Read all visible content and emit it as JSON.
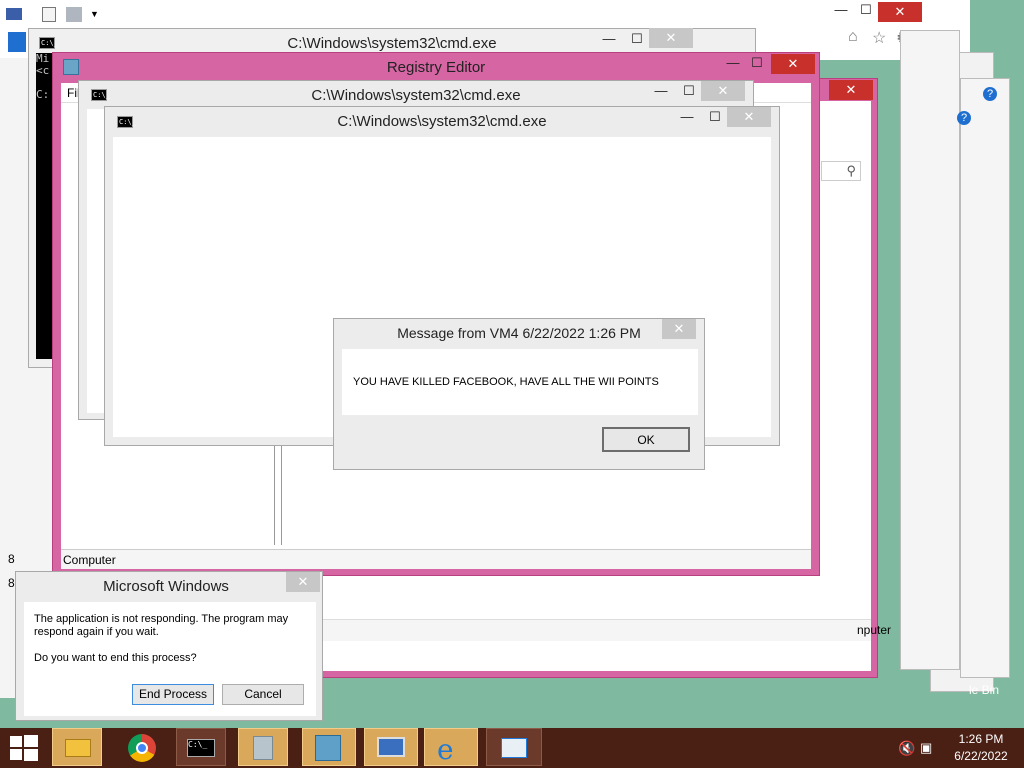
{
  "browser": {
    "close_glyph": "✕",
    "min_glyph": "—",
    "max_glyph": "☐"
  },
  "cmd_back": {
    "title": "C:\\Windows\\system32\\cmd.exe",
    "console_text": "Mi\n<c\n\nC:"
  },
  "registry": {
    "title": "Registry Editor",
    "menu_file": "Fil",
    "status": "Computer"
  },
  "cmd_mid": {
    "title": "C:\\Windows\\system32\\cmd.exe"
  },
  "cmd_front": {
    "title": "C:\\Windows\\system32\\cmd.exe"
  },
  "message": {
    "title": "Message from VM4 6/22/2022 1:26 PM",
    "body": "YOU HAVE KILLED FACEBOOK, HAVE ALL THE WII POINTS",
    "ok_label": "OK"
  },
  "not_responding": {
    "title": "Microsoft Windows",
    "line1": "The application is not responding. The program may respond again if you wait.",
    "line2": "Do you want to end this process?",
    "end_label": "End Process",
    "cancel_label": "Cancel"
  },
  "behind": {
    "computer_partial": "nputer",
    "recycle_partial": "le Bin",
    "left_8a": "8",
    "left_8b": "8"
  },
  "taskbar": {
    "time": "1:26 PM",
    "date": "6/22/2022",
    "icons": [
      "windows-start",
      "file-explorer",
      "chrome",
      "cmd",
      "calculator",
      "registry-editor",
      "remote-desktop",
      "internet-explorer",
      "window-app"
    ]
  },
  "colors": {
    "accent_pink": "#d565a3",
    "close_red": "#c7302b",
    "taskbar": "#4a1f14"
  }
}
